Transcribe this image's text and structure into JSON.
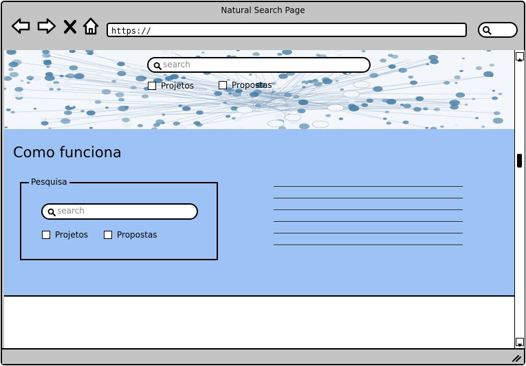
{
  "window": {
    "title": "Natural Search Page"
  },
  "browser": {
    "url": "https://",
    "back_icon": "arrow-left-icon",
    "forward_icon": "arrow-right-icon",
    "close_icon": "x-icon",
    "home_icon": "home-icon",
    "search_icon": "search-icon"
  },
  "hero": {
    "search": {
      "placeholder": "search"
    },
    "filters": [
      {
        "label": "Projetos",
        "checked": false
      },
      {
        "label": "Propostas",
        "checked": false
      }
    ]
  },
  "main": {
    "title": "Como funciona",
    "panel": {
      "legend": "Pesquisa",
      "search": {
        "placeholder": "search"
      },
      "filters": [
        {
          "label": "Projetos",
          "checked": false
        },
        {
          "label": "Propostas",
          "checked": false
        }
      ]
    }
  },
  "colors": {
    "content_background": "#9dc2f5",
    "chrome": "#c4c4c4",
    "network_nodes": "#4a7fa7"
  }
}
